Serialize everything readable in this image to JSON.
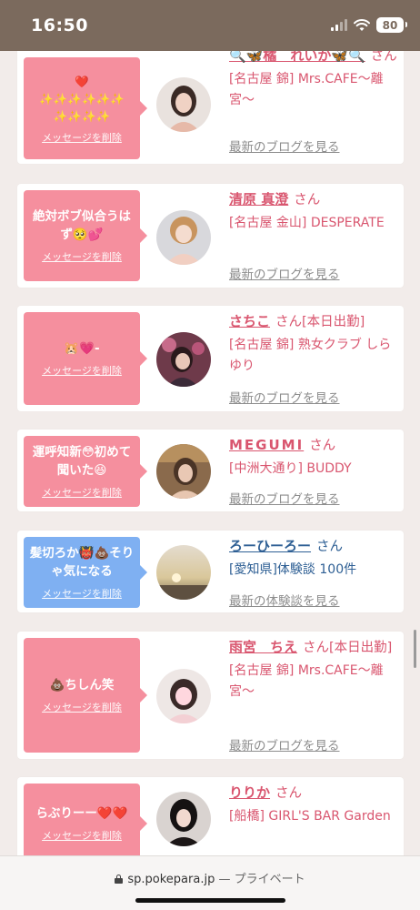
{
  "status_bar": {
    "time": "16:50",
    "battery": "80"
  },
  "cards": [
    {
      "message": "❤️\n✨✨✨✨✨✨\n✨✨✨✨",
      "delete_label": "メッセージを削除",
      "name": "🔍🦋橘　れいか🦋🔍",
      "san": "さん",
      "status": "",
      "shop": "[名古屋 錦] Mrs.CAFE〜離宮〜",
      "link": "最新のブログを見る",
      "color": "pink"
    },
    {
      "message": "絶対ボブ似合うはず🥺💕",
      "delete_label": "メッセージを削除",
      "name": "清原 真澄",
      "san": "さん",
      "status": "",
      "shop": "[名古屋 金山] DESPERATE",
      "link": "最新のブログを見る",
      "color": "pink"
    },
    {
      "message": "🐹💗-",
      "delete_label": "メッセージを削除",
      "name": "さちこ",
      "san": "さん",
      "status": "[本日出勤]",
      "shop": "[名古屋 錦] 熟女クラブ しらゆり",
      "link": "最新のブログを見る",
      "color": "pink"
    },
    {
      "message": "運呼知新😳初めて聞いた😆",
      "delete_label": "メッセージを削除",
      "name": "MEGUMI",
      "san": "さん",
      "status": "",
      "shop": "[中洲大通り] BUDDY",
      "link": "最新のブログを見る",
      "color": "pink"
    },
    {
      "message": "髪切ろか👹💩そりゃ気になる",
      "delete_label": "メッセージを削除",
      "name": "ろーひーろー",
      "san": "さん",
      "status": "",
      "shop": "[愛知県]体験談 100件",
      "link": "最新の体験談を見る",
      "color": "blue"
    },
    {
      "message": "💩ちしん笑",
      "delete_label": "メッセージを削除",
      "name": "雨宮　ちえ",
      "san": "さん",
      "status": "[本日出勤]",
      "shop": "[名古屋 錦] Mrs.CAFE〜離宮〜",
      "link": "最新のブログを見る",
      "color": "pink"
    },
    {
      "message": "らぶりーー❤️❤️",
      "delete_label": "メッセージを削除",
      "name": "りりか",
      "san": "さん",
      "status": "",
      "shop": "[船橋] GIRL'S BAR Garden",
      "link": "最新のブログを見る",
      "color": "pink"
    }
  ],
  "browser": {
    "url": "sp.pokepara.jp",
    "separator": "—",
    "mode": "プライベート"
  },
  "colors": {
    "accent_pink": "#f58f9e",
    "accent_blue": "#7fb0f2",
    "name_pink": "#d9566f",
    "name_blue": "#2e5f94"
  }
}
